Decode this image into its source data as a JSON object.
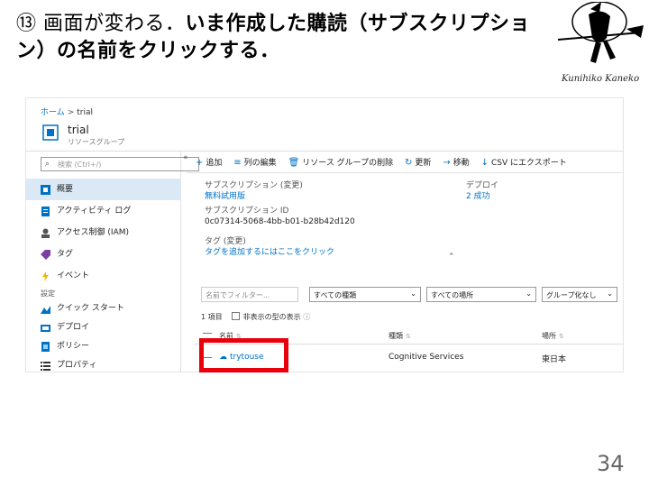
{
  "slide": {
    "heading_lead": "⑬ 画面が変わる．",
    "heading_bold": "いま作成した購読（サブスクリプション）の名前をクリックする．",
    "signature": "Kunihiko Kaneko",
    "page_number": "34"
  },
  "portal": {
    "breadcrumb": {
      "home": "ホーム",
      "separator": ">",
      "current": "trial"
    },
    "resource": {
      "title": "trial",
      "subtitle": "リソースグループ",
      "icon": "resource-group-icon"
    },
    "search_placeholder": "検索 (Ctrl+/)",
    "collapse_label": "«",
    "nav": [
      {
        "label": "概要",
        "icon": "overview-icon",
        "active": true
      },
      {
        "label": "アクティビティ ログ",
        "icon": "activity-log-icon"
      },
      {
        "label": "アクセス制御 (IAM)",
        "icon": "iam-icon"
      },
      {
        "label": "タグ",
        "icon": "tag-icon"
      },
      {
        "label": "イベント",
        "icon": "event-icon"
      }
    ],
    "settings_section": "設定",
    "settings_nav": [
      {
        "label": "クイック スタート",
        "icon": "quickstart-icon"
      },
      {
        "label": "デプロイ",
        "icon": "deploy-icon"
      },
      {
        "label": "ポリシー",
        "icon": "policy-icon"
      },
      {
        "label": "プロパティ",
        "icon": "properties-icon"
      }
    ],
    "toolbar": [
      {
        "label": "追加",
        "icon": "+"
      },
      {
        "label": "列の編集",
        "icon": "≡"
      },
      {
        "label": "リソース グループの削除",
        "icon": "🗑"
      },
      {
        "label": "更新",
        "icon": "↻"
      },
      {
        "label": "移動",
        "icon": "→"
      },
      {
        "label": "CSV にエクスポート",
        "icon": "↓"
      }
    ],
    "essentials": {
      "subscription_label": "サブスクリプション (変更)",
      "subscription_value": "無料試用版",
      "subscription_id_label": "サブスクリプション ID",
      "subscription_id_value": "0c07314-5068-4bb-b01-b28b42d120",
      "tags_label": "タグ (変更)",
      "tags_value": "タグを追加するにはここをクリック",
      "deploy_label": "デプロイ",
      "deploy_value": "2 成功",
      "collapse_chevron": "⌃"
    },
    "filters": {
      "name_placeholder": "名前でフィルター...",
      "type_value": "すべての種類",
      "location_value": "すべての場所",
      "group_value": "グループ化なし"
    },
    "count_text": "1 項目",
    "show_hidden_label": "非表示の型の表示",
    "table": {
      "headers": [
        "名前",
        "種類",
        "場所"
      ],
      "rows": [
        {
          "name": "trytouse",
          "type": "Cognitive Services",
          "location": "東日本"
        }
      ]
    }
  },
  "colors": {
    "accent": "#0072c6",
    "highlight": "#e8000b",
    "nav_active": "#dbe9f6"
  }
}
